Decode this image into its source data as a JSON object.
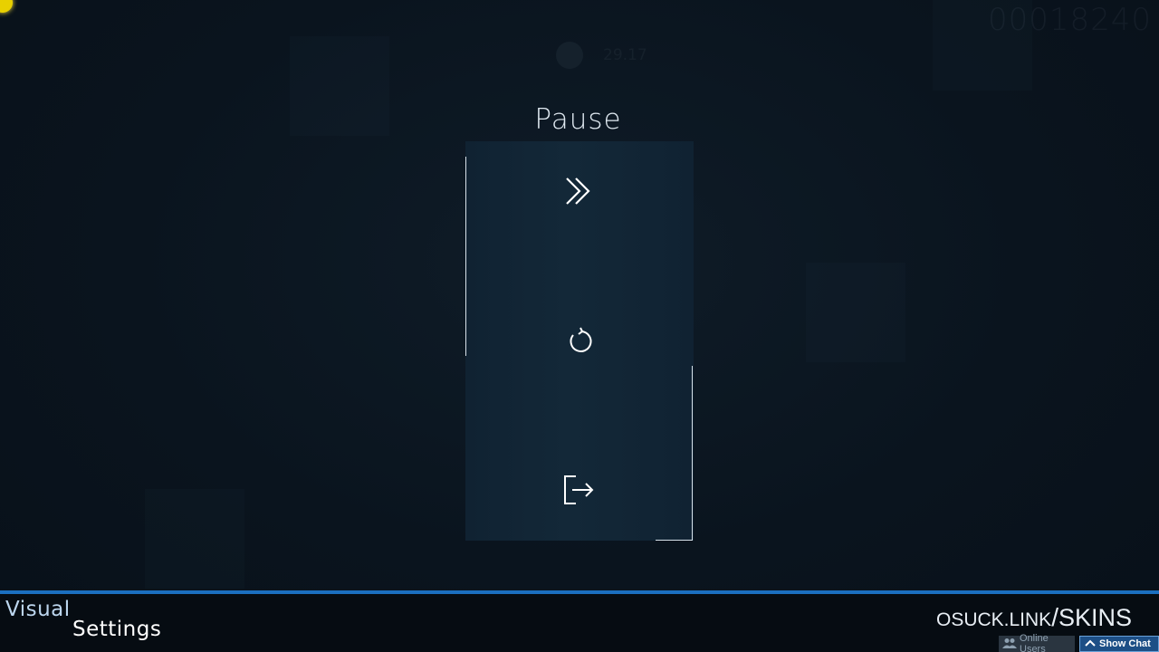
{
  "game": {
    "score": "00018240",
    "time_remaining": "29.17"
  },
  "pause_menu": {
    "title": "Pause",
    "buttons": [
      {
        "action": "continue",
        "icon": "double-chevron-right-icon"
      },
      {
        "action": "retry",
        "icon": "retry-arrow-icon"
      },
      {
        "action": "quit",
        "icon": "exit-door-icon"
      }
    ]
  },
  "footer": {
    "visual_settings_word1": "Visual",
    "visual_settings_word2": "Settings",
    "brand_domain": "OSUCK.LINK",
    "brand_separator": "/",
    "brand_page": "SKINS",
    "online_users_label": "Online Users",
    "show_chat_label": "Show Chat"
  },
  "colors": {
    "accent_blue": "#1b6fbf",
    "menu_panel": "#132838",
    "cursor_yellow": "#e8d000"
  }
}
